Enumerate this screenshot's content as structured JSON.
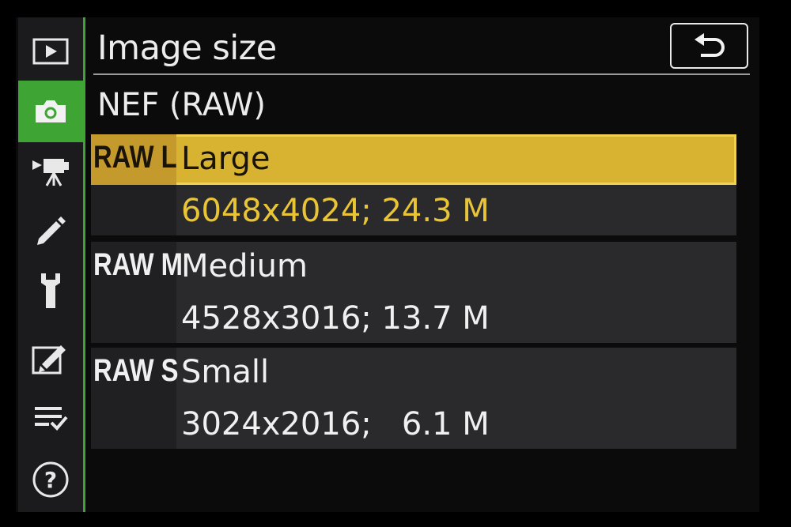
{
  "tabs": [
    {
      "name": "playback-menu-tab",
      "icon": "playback-icon",
      "active": false
    },
    {
      "name": "photo-shooting-menu-tab",
      "icon": "camera-icon",
      "active": true
    },
    {
      "name": "movie-shooting-menu-tab",
      "icon": "movie-camera-icon",
      "active": false
    },
    {
      "name": "custom-settings-menu-tab",
      "icon": "pencil-icon",
      "active": false
    },
    {
      "name": "setup-menu-tab",
      "icon": "wrench-icon",
      "active": false
    },
    {
      "name": "retouch-menu-tab",
      "icon": "retouch-icon",
      "active": false
    },
    {
      "name": "my-menu-tab",
      "icon": "my-menu-icon",
      "active": false
    },
    {
      "name": "help-tab",
      "icon": "help-icon",
      "active": false
    }
  ],
  "header": {
    "title": "Image size",
    "back_icon": "return-arrow-icon"
  },
  "section_title": "NEF (RAW)",
  "options": [
    {
      "code": "RAW L",
      "name": "Large",
      "resolution": "6048x4024; 24.3 M",
      "selected": true
    },
    {
      "code": "RAW M",
      "name": "Medium",
      "resolution": "4528x3016; 13.7 M",
      "selected": false
    },
    {
      "code": "RAW S",
      "name": "Small",
      "resolution": "3024x2016;   6.1 M",
      "selected": false
    }
  ],
  "colors": {
    "accent_green": "#3ea534",
    "selection_yellow": "#d7b331",
    "selected_value_yellow": "#e9c435"
  }
}
